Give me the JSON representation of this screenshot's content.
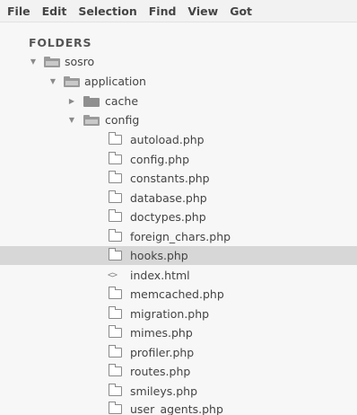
{
  "menu": [
    "File",
    "Edit",
    "Selection",
    "Find",
    "View",
    "Got"
  ],
  "sidebar": {
    "header": "FOLDERS",
    "tree": {
      "root": "sosro",
      "application": "application",
      "cache": "cache",
      "config": "config",
      "files": [
        "autoload.php",
        "config.php",
        "constants.php",
        "database.php",
        "doctypes.php",
        "foreign_chars.php",
        "hooks.php",
        "index.html",
        "memcached.php",
        "migration.php",
        "mimes.php",
        "profiler.php",
        "routes.php",
        "smileys.php",
        "user_agents.php"
      ],
      "selected": "hooks.php"
    }
  }
}
